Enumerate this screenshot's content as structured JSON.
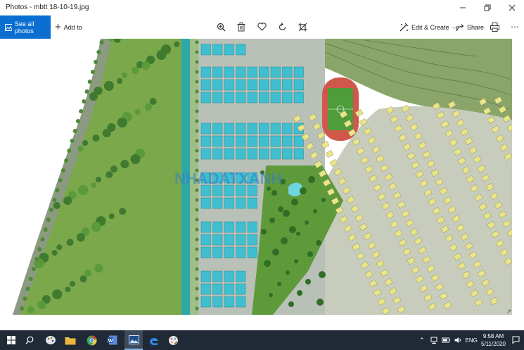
{
  "window": {
    "title": "Photos - mbtt 18-10-19.jpg"
  },
  "toolbar": {
    "see_all_label": "See all photos",
    "add_to_label": "Add to",
    "edit_create_label": "Edit & Create",
    "share_label": "Share"
  },
  "photo": {
    "watermark": "NHADATXANH"
  },
  "taskbar": {
    "language": "ENG",
    "time": "9:58 AM",
    "date": "5/11/2020"
  },
  "colors": {
    "accent": "#0a6fd1",
    "taskbar": "#1f2a36",
    "villa_lots": "#e8e58a",
    "blue_lots": "#3fbfcf",
    "park_green": "#7aa84a"
  }
}
